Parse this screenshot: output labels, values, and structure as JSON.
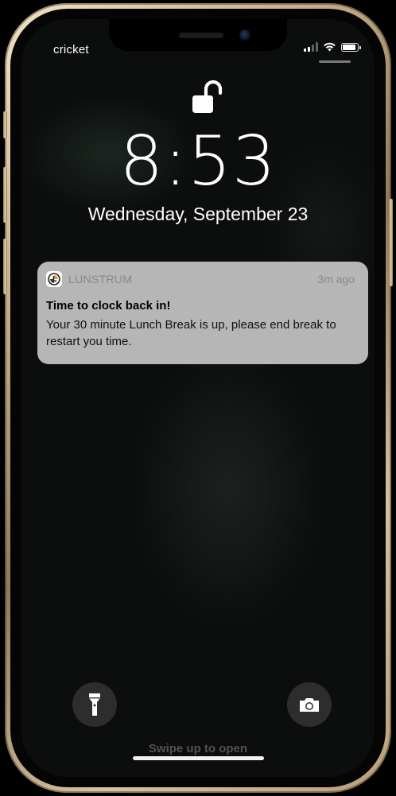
{
  "status_bar": {
    "carrier": "cricket",
    "signal_bars": 4,
    "signal_bars_active": 2,
    "wifi_icon": "wifi-icon",
    "battery_icon": "battery-icon",
    "battery_level": 0.9
  },
  "lock_screen": {
    "lock_icon": "unlocked-padlock-icon",
    "time": "8:53",
    "date": "Wednesday, September 23"
  },
  "notification": {
    "app_icon": "lunstrum-logo-icon",
    "app_name": "LUNSTRUM",
    "time_ago": "3m ago",
    "title": "Time to clock back in!",
    "body": "Your 30 minute Lunch Break is up, please end break to restart you time."
  },
  "quick_actions": {
    "flashlight_icon": "flashlight-icon",
    "camera_icon": "camera-icon"
  },
  "footer": {
    "swipe_hint": "Swipe up to open"
  },
  "colors": {
    "frame_gold": "#c9b08a",
    "notification_bg": "#c4c4c4",
    "screen_bg": "#0c0d0d"
  }
}
